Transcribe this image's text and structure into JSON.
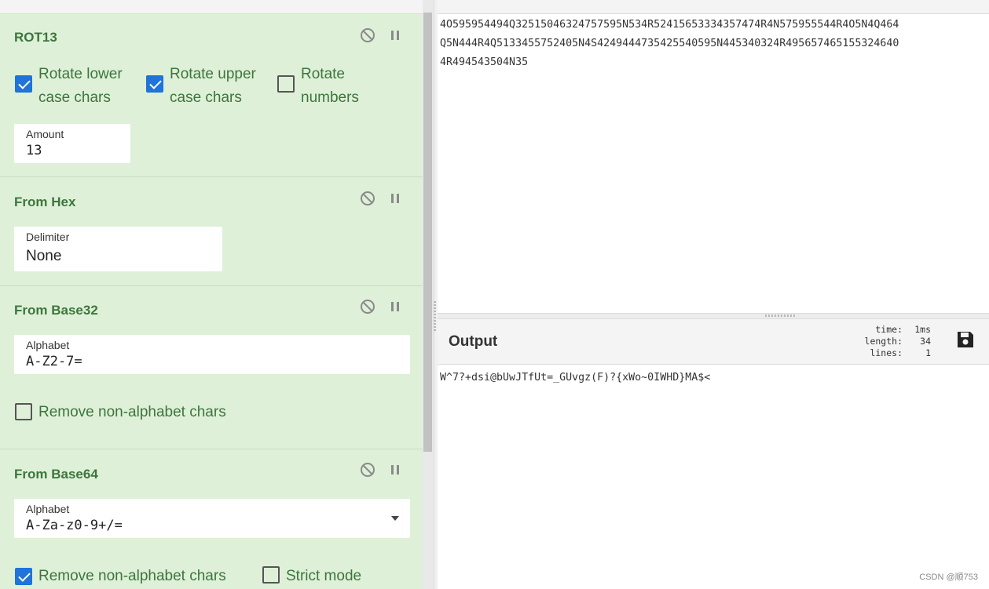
{
  "recipe": {
    "ops": [
      {
        "title": "ROT13",
        "checkboxes": [
          {
            "label_line1": "Rotate lower",
            "label_line2": "case chars",
            "checked": true
          },
          {
            "label_line1": "Rotate upper",
            "label_line2": "case chars",
            "checked": true
          },
          {
            "label_line1": "Rotate",
            "label_line2": "numbers",
            "checked": false
          }
        ],
        "amount": {
          "label": "Amount",
          "value": "13"
        }
      },
      {
        "title": "From Hex",
        "delimiter": {
          "label": "Delimiter",
          "value": "None"
        }
      },
      {
        "title": "From Base32",
        "alphabet": {
          "label": "Alphabet",
          "value": "A-Z2-7="
        },
        "remove_non_alphabet": {
          "label": "Remove non-alphabet chars",
          "checked": false
        }
      },
      {
        "title": "From Base64",
        "alphabet": {
          "label": "Alphabet",
          "value": "A-Za-z0-9+/="
        },
        "remove_non_alphabet": {
          "label": "Remove non-alphabet chars",
          "checked": true
        },
        "strict_mode": {
          "label": "Strict mode",
          "checked": false
        }
      }
    ]
  },
  "input": {
    "lines": [
      "4O595954494Q32515046324757595N534R52415653334357474R4N575955544R4O5N4Q464",
      "Q5N444R4Q5133455752405N4S4249444735425540595N445340324R495657465155324640",
      "4R494543504N35"
    ]
  },
  "output": {
    "title": "Output",
    "stats": {
      "time_label": "time:",
      "time_value": "1ms",
      "length_label": "length:",
      "length_value": "34",
      "lines_label": "lines:",
      "lines_value": "1"
    },
    "text": "W^7?+dsi@bUwJTfUt=_GUvgz(F)?{xWo~0IWHD}MA$<",
    "save_icon": "save-icon"
  },
  "watermark": "CSDN @顺753",
  "colors": {
    "recipe_bg": "#dff0d8",
    "op_title": "#3c763d",
    "checkbox_checked": "#1f73d9"
  }
}
